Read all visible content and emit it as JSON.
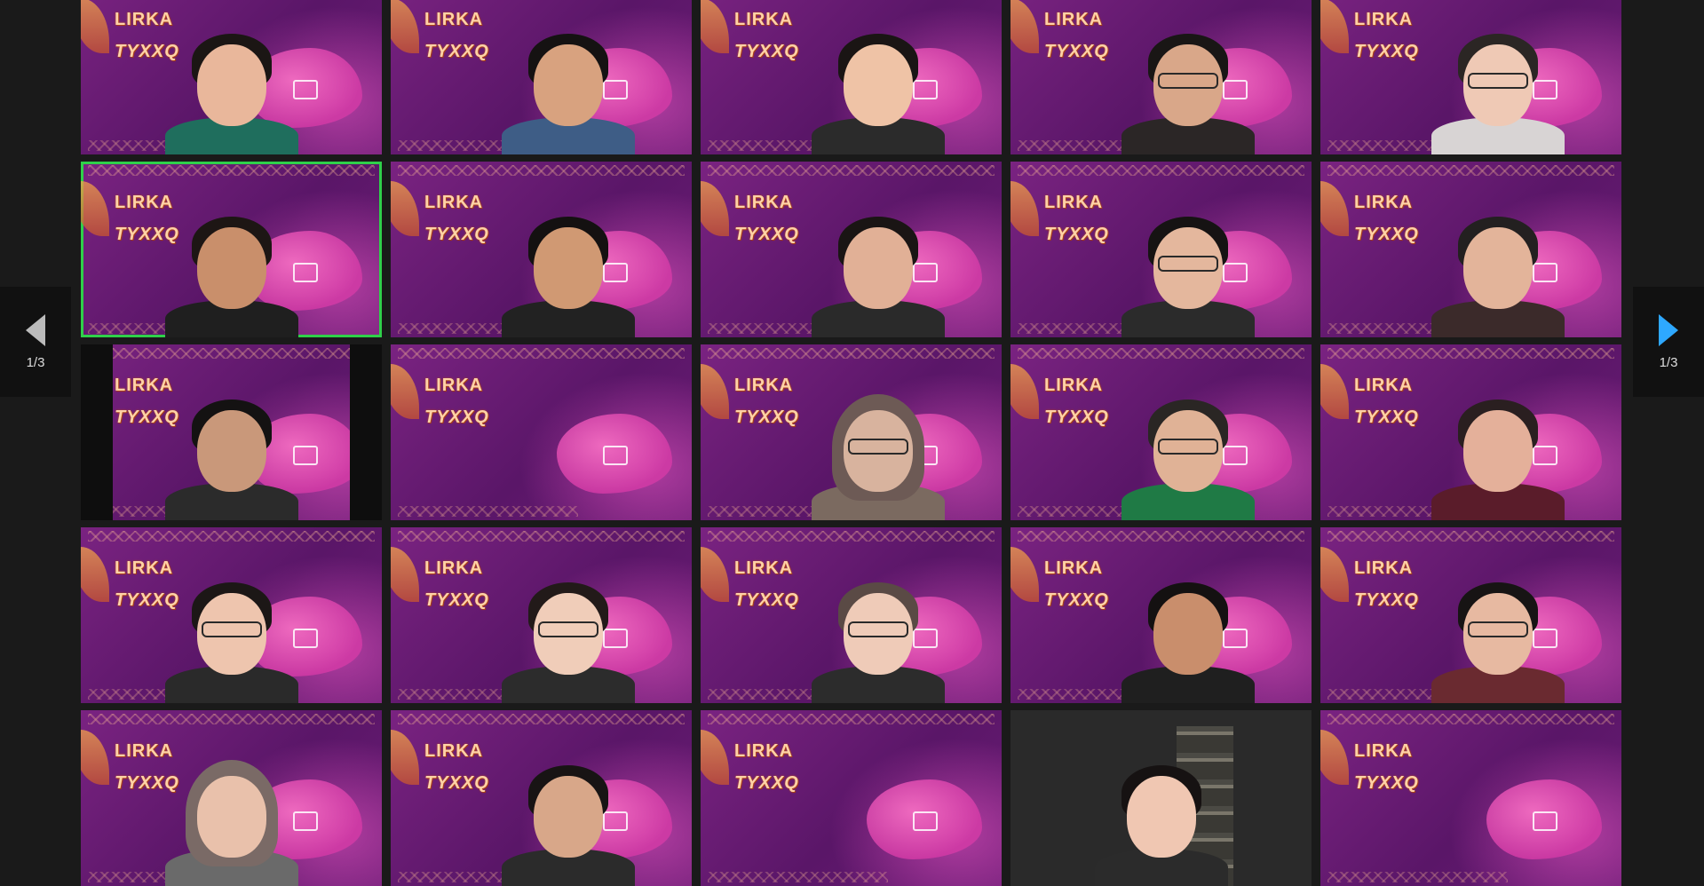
{
  "call": {
    "brand_line1": "LIRKA",
    "brand_line2": "TYXXQ"
  },
  "navigation": {
    "prev_page": "1/3",
    "next_page": "1/3"
  },
  "tiles": [
    {
      "kind": "branded",
      "skin": "#e9b79b",
      "hair": "#1b1614",
      "shirt": "#1f6e5d",
      "glasses": false
    },
    {
      "kind": "branded",
      "skin": "#d8a27f",
      "hair": "#151212",
      "shirt": "#3e5d86",
      "glasses": false
    },
    {
      "kind": "branded",
      "skin": "#efc3a6",
      "hair": "#1a1514",
      "shirt": "#2b2b2b",
      "glasses": false
    },
    {
      "kind": "branded",
      "skin": "#d9a789",
      "hair": "#191615",
      "shirt": "#2b2626",
      "glasses": true
    },
    {
      "kind": "branded",
      "skin": "#efc9b5",
      "hair": "#2b2624",
      "shirt": "#d8d4d4",
      "glasses": true
    },
    {
      "kind": "branded",
      "skin": "#c98f6b",
      "hair": "#1d1614",
      "shirt": "#1f1f1f",
      "glasses": false,
      "active": true
    },
    {
      "kind": "branded",
      "skin": "#d09973",
      "hair": "#141111",
      "shirt": "#222",
      "glasses": false
    },
    {
      "kind": "branded",
      "skin": "#e1b096",
      "hair": "#1a1514",
      "shirt": "#2a2a2a",
      "glasses": false
    },
    {
      "kind": "branded",
      "skin": "#e4b79d",
      "hair": "#161313",
      "shirt": "#2b2b2b",
      "glasses": true
    },
    {
      "kind": "branded",
      "skin": "#e3b49a",
      "hair": "#232020",
      "shirt": "#3b2a2a",
      "glasses": false
    },
    {
      "kind": "branded",
      "skin": "#c9987a",
      "hair": "#141212",
      "shirt": "#2b2b2b",
      "glasses": false,
      "letterbox": true
    },
    {
      "kind": "branded",
      "empty": true
    },
    {
      "kind": "branded",
      "skin": "#d8b39e",
      "hair": "#6d5a55",
      "shirt": "#7b6a60",
      "glasses": true,
      "hijab": true
    },
    {
      "kind": "branded",
      "skin": "#e0b296",
      "hair": "#2a2624",
      "shirt": "#1f7a45",
      "glasses": true
    },
    {
      "kind": "branded",
      "skin": "#e4b09a",
      "hair": "#2a1f20",
      "shirt": "#5a1c2a",
      "glasses": false
    },
    {
      "kind": "branded",
      "skin": "#eec5ae",
      "hair": "#1c1716",
      "shirt": "#2a2a2a",
      "glasses": true
    },
    {
      "kind": "branded",
      "skin": "#f0cdb9",
      "hair": "#221a19",
      "shirt": "#2c2c2c",
      "glasses": true
    },
    {
      "kind": "branded",
      "skin": "#efcbb8",
      "hair": "#5a4a45",
      "shirt": "#2c2c2c",
      "glasses": true
    },
    {
      "kind": "branded",
      "skin": "#c98e6c",
      "hair": "#141111",
      "shirt": "#1f1f1f",
      "glasses": false
    },
    {
      "kind": "branded",
      "skin": "#e7b9a1",
      "hair": "#171414",
      "shirt": "#6a2a30",
      "glasses": true
    },
    {
      "kind": "branded",
      "skin": "#e9c1ab",
      "hair": "#7a6a66",
      "shirt": "#6a6a6a",
      "glasses": false,
      "hijab": true
    },
    {
      "kind": "branded",
      "skin": "#d8a789",
      "hair": "#181414",
      "shirt": "#2b2b2b",
      "glasses": false
    },
    {
      "kind": "branded",
      "empty": true
    },
    {
      "kind": "plain",
      "skin": "#f0c7b2",
      "hair": "#161212",
      "shirt": "#2b2b2b",
      "glasses": false
    },
    {
      "kind": "branded",
      "empty": true
    }
  ]
}
